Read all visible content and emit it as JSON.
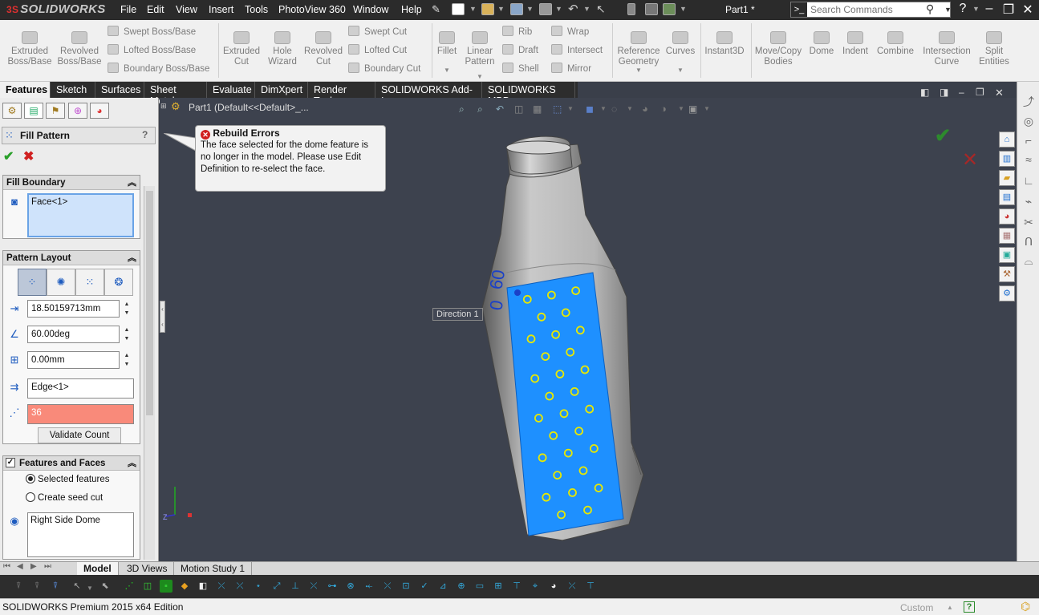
{
  "app": {
    "logo_text": "SOLIDWORKS",
    "logo_mark": "3S",
    "document_title": "Part1 *"
  },
  "menu": [
    "File",
    "Edit",
    "View",
    "Insert",
    "Tools",
    "PhotoView 360",
    "Window",
    "Help"
  ],
  "search": {
    "placeholder": "Search Commands"
  },
  "window_controls": {
    "help": "?",
    "minimize": "–",
    "restore": "❐",
    "close": "✕"
  },
  "ribbon": {
    "boss_buttons": [
      {
        "label": "Extruded\nBoss/Base",
        "icon": "extruded-boss-icon"
      },
      {
        "label": "Revolved\nBoss/Base",
        "icon": "revolved-boss-icon"
      }
    ],
    "boss_small": [
      "Swept Boss/Base",
      "Lofted Boss/Base",
      "Boundary Boss/Base"
    ],
    "cut_buttons": [
      {
        "label": "Extruded\nCut",
        "icon": "extruded-cut-icon"
      },
      {
        "label": "Hole\nWizard",
        "icon": "hole-wizard-icon"
      },
      {
        "label": "Revolved\nCut",
        "icon": "revolved-cut-icon"
      }
    ],
    "cut_small": [
      "Swept Cut",
      "Lofted Cut",
      "Boundary Cut"
    ],
    "feature_buttons": [
      {
        "label": "Fillet",
        "icon": "fillet-icon"
      },
      {
        "label": "Linear\nPattern",
        "icon": "linear-pattern-icon"
      }
    ],
    "feature_small_a": [
      "Rib",
      "Draft",
      "Shell"
    ],
    "feature_small_b": [
      "Wrap",
      "Intersect",
      "Mirror"
    ],
    "other_buttons": [
      {
        "label": "Reference\nGeometry",
        "icon": "reference-geometry-icon"
      },
      {
        "label": "Curves",
        "icon": "curves-icon"
      },
      {
        "label": "Instant3D",
        "icon": "instant3d-icon"
      },
      {
        "label": "Move/Copy\nBodies",
        "icon": "move-copy-icon"
      },
      {
        "label": "Dome",
        "icon": "dome-icon"
      },
      {
        "label": "Indent",
        "icon": "indent-icon"
      },
      {
        "label": "Combine",
        "icon": "combine-icon"
      },
      {
        "label": "Intersection\nCurve",
        "icon": "intersection-curve-icon"
      },
      {
        "label": "Split\nEntities",
        "icon": "split-entities-icon"
      }
    ]
  },
  "command_tabs": [
    "Features",
    "Sketch",
    "Surfaces",
    "Sheet Metal",
    "Evaluate",
    "DimXpert",
    "Render Tools",
    "SOLIDWORKS Add-Ins",
    "SOLIDWORKS MBD"
  ],
  "property_manager": {
    "title": "Fill Pattern",
    "help": "?",
    "ok": "✔",
    "cancel": "✖",
    "fill_boundary": {
      "header": "Fill Boundary",
      "value": "Face<1>"
    },
    "pattern_layout": {
      "header": "Pattern Layout",
      "spacing": "18.50159713mm",
      "angle": "60.00deg",
      "margin": "0.00mm",
      "direction": "Edge<1>",
      "count": "36",
      "validate_label": "Validate Count"
    },
    "features_faces": {
      "header": "Features and Faces",
      "options": [
        {
          "label": "Selected features",
          "checked": true
        },
        {
          "label": "Create seed cut",
          "checked": false
        }
      ],
      "selected": "Right Side Dome"
    }
  },
  "tree": {
    "label": "Part1  (Default<<Default>_..."
  },
  "callout": {
    "title": "Rebuild Errors",
    "message": "The face selected for the dome feature is no longer in the model. Please use Edit Definition to re-select the face."
  },
  "viewport": {
    "direction_label": "Direction 1",
    "dim_text": "60",
    "ok": "✔",
    "cancel": "✕"
  },
  "bottom_tabs": [
    "Model",
    "3D Views",
    "Motion Study 1"
  ],
  "status": {
    "edition": "SOLIDWORKS Premium 2015 x64 Edition",
    "units": "Custom",
    "help": "?"
  },
  "colors": {
    "accent": "#1e90ff",
    "dot": "#e8e800",
    "error_field": "#f98a7a",
    "panel": "#ececec",
    "viewport": "#3d424e"
  }
}
